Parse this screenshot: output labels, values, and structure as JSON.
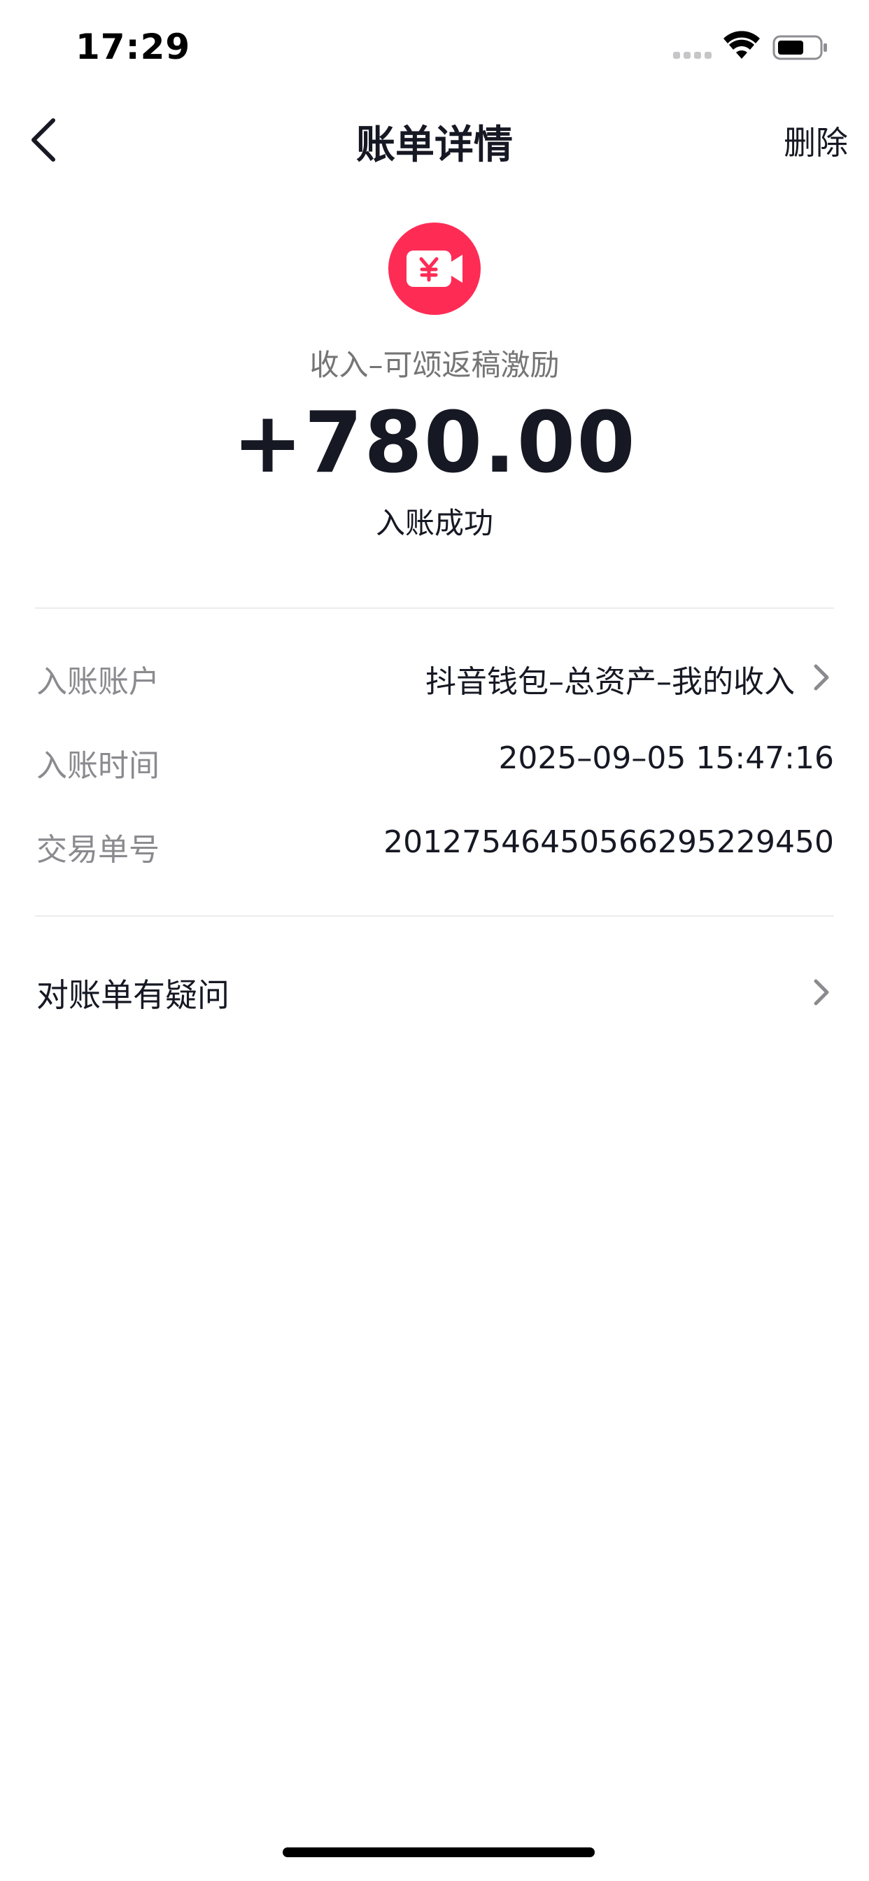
{
  "status_bar": {
    "time": "17:29"
  },
  "nav": {
    "title": "账单详情",
    "delete_label": "删除"
  },
  "hero": {
    "icon": "yen-video-icon",
    "label": "收入–可颂返稿激励",
    "amount": "+780.00",
    "status": "入账成功",
    "accent_color": "#fe2c55"
  },
  "details": [
    {
      "label": "入账账户",
      "value": "抖音钱包–总资产–我的收入",
      "has_arrow": true
    },
    {
      "label": "入账时间",
      "value": "2025–09–05 15:47:16",
      "has_arrow": false
    },
    {
      "label": "交易单号",
      "value": "2012754645056629522945​0",
      "has_arrow": false
    }
  ],
  "question": {
    "label": "对账单有疑问"
  }
}
